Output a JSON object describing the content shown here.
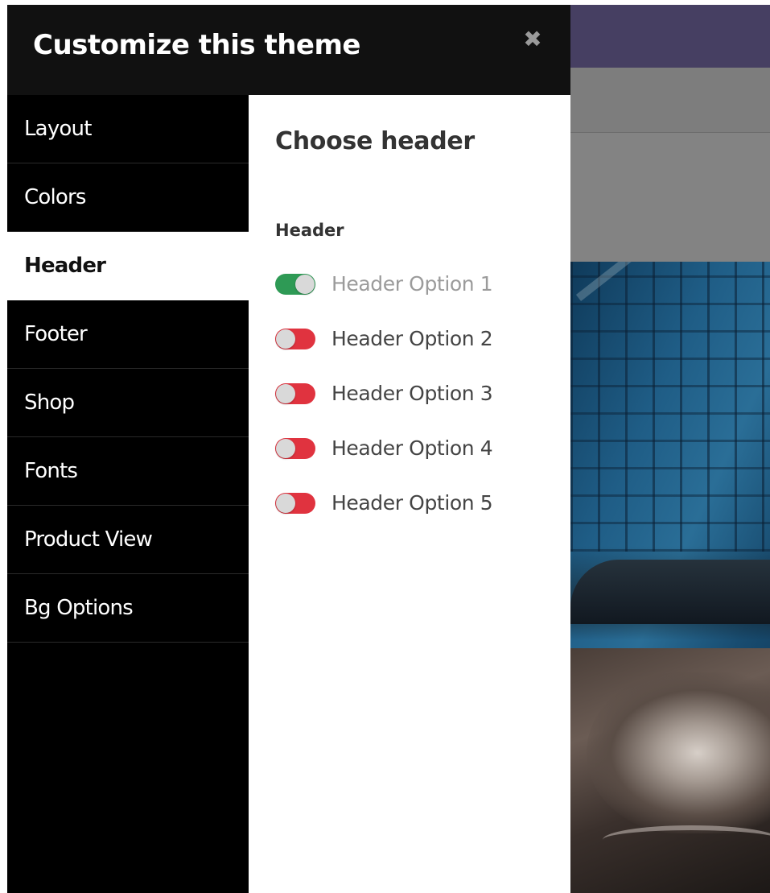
{
  "panel": {
    "title": "Customize this theme",
    "close_icon": "close-icon"
  },
  "nav": {
    "items": [
      {
        "label": "Layout",
        "active": false
      },
      {
        "label": "Colors",
        "active": false
      },
      {
        "label": "Header",
        "active": true
      },
      {
        "label": "Footer",
        "active": false
      },
      {
        "label": "Shop",
        "active": false
      },
      {
        "label": "Fonts",
        "active": false
      },
      {
        "label": "Product View",
        "active": false
      },
      {
        "label": "Bg Options",
        "active": false
      }
    ]
  },
  "content": {
    "section_title": "Choose header",
    "group_label": "Header",
    "options": [
      {
        "label": "Header Option 1",
        "enabled": true
      },
      {
        "label": "Header Option 2",
        "enabled": false
      },
      {
        "label": "Header Option 3",
        "enabled": false
      },
      {
        "label": "Header Option 4",
        "enabled": false
      },
      {
        "label": "Header Option 5",
        "enabled": false
      }
    ]
  },
  "colors": {
    "toggle_on": "#2e9a55",
    "toggle_off": "#e0333f",
    "panel_bg": "#000000",
    "header_bg": "#111111",
    "topbar_bg": "#463f62"
  }
}
